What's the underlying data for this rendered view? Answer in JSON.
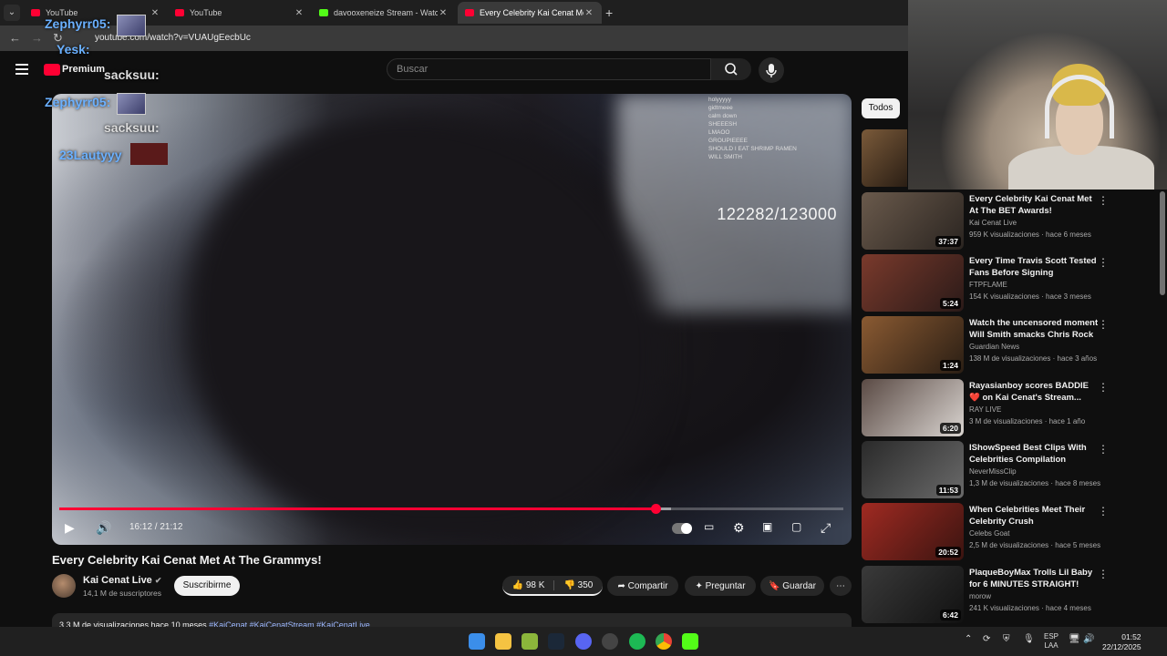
{
  "browser": {
    "tabs": [
      {
        "title": "YouTube",
        "color": "#ff0033"
      },
      {
        "title": "YouTube",
        "color": "#ff0033"
      },
      {
        "title": "davooxeneize Stream - Watch L",
        "color": "#53fc18"
      },
      {
        "title": "Every Celebrity Kai Cenat Met A",
        "color": "#ff0033"
      }
    ],
    "url": "youtube.com/watch?v=VUAUgEecbUc"
  },
  "header": {
    "logo_label": "Premium",
    "search_placeholder": "Buscar"
  },
  "overlay": {
    "lines": [
      "Zephyrr05:",
      "Yesk:",
      "sacksuu:",
      "Zephyrr05:",
      "sacksuu:",
      "23Lautyyy"
    ]
  },
  "player": {
    "counter": "122282/123000",
    "time": "16:12 / 21:12",
    "progress": 0.76,
    "buffered": 0.78,
    "chat_lines": [
      "holyyyyy",
      "gidtmeee",
      "calm down",
      "SHEEESH",
      "LMAOO",
      "GROUPIEEEE",
      "SHOULD I EAT SHRIMP RAMEN",
      "WILL SMITH"
    ]
  },
  "video": {
    "title": "Every Celebrity Kai Cenat Met At The Grammys!",
    "channel": "Kai Cenat Live",
    "subscribers": "14,1 M de suscriptores",
    "subscribe_label": "Suscribirme",
    "likes": "98 K",
    "dislikes": "350",
    "share_label": "Compartir",
    "ask_label": "Preguntar",
    "save_label": "Guardar",
    "views_date": "3,3 M de visualizaciones  hace 10 meses",
    "tags": "#KaiCenat #KaiCenatStream #KaiCenatLive"
  },
  "sidebar": {
    "chip": "Todos",
    "recommendations": [
      {
        "title": "Every Celebrity Kai Cenat Met At The BET Awards!",
        "channel": "Kai Cenat Live",
        "meta": "959 K visualizaciones · hace 6 meses",
        "duration": "37:37",
        "thumb": "#5a4a3c"
      },
      {
        "title": "Every Time Travis Scott Tested Fans Before Signing Autograp...",
        "channel": "FTPFLAME",
        "meta": "154 K visualizaciones · hace 3 meses",
        "duration": "5:24",
        "thumb": "#6a2a22"
      },
      {
        "title": "Watch the uncensored moment Will Smith smacks Chris Rock ...",
        "channel": "Guardian News",
        "meta": "138 M de visualizaciones · hace 3 años",
        "duration": "1:24",
        "thumb": "#5a3a22"
      },
      {
        "title": "Rayasianboy scores BADDIE❤️ on Kai Cenat's Stream...",
        "channel": "RAY LIVE",
        "meta": "3 M de visualizaciones · hace 1 año",
        "duration": "6:20",
        "thumb": "#4a3e3a"
      },
      {
        "title": "IShowSpeed Best Clips With Celebrities Compilation",
        "channel": "NeverMissClip",
        "meta": "1,3 M de visualizaciones · hace 8 meses",
        "duration": "11:53",
        "thumb": "#3a3a3a"
      },
      {
        "title": "When Celebrities Meet Their Celebrity Crush",
        "channel": "Celebs Goat",
        "meta": "2,5 M de visualizaciones · hace 5 meses",
        "duration": "20:52",
        "thumb": "#8a2a22"
      },
      {
        "title": "PlaqueBoyMax Trolls Lil Baby for 6 MINUTES STRAIGHT!",
        "channel": "morow",
        "meta": "241 K visualizaciones · hace 4 meses",
        "duration": "6:42",
        "thumb": "#2a2a2a"
      }
    ]
  },
  "taskbar": {
    "lang": "ESP",
    "lang2": "LAA",
    "time": "01:52",
    "date": "22/12/2025"
  }
}
